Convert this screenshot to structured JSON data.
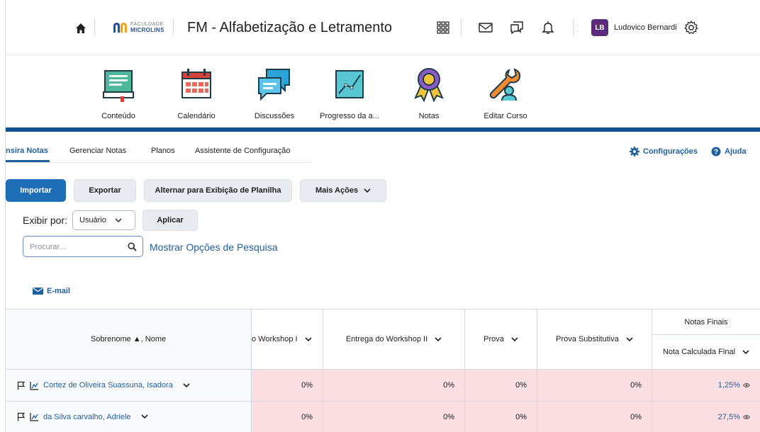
{
  "header": {
    "logo_top": "FACULDADE",
    "logo_bottom": "MICROLINS",
    "course_title": "FM - Alfabetização e Letramento",
    "user_initials": "LB",
    "user_name": "Ludovico Bernardi"
  },
  "nav": {
    "items": [
      {
        "label": "Conteúdo",
        "icon": "book-icon"
      },
      {
        "label": "Calendário",
        "icon": "calendar-icon"
      },
      {
        "label": "Discussões",
        "icon": "discussion-icon"
      },
      {
        "label": "Progresso da a...",
        "icon": "progress-chart-icon"
      },
      {
        "label": "Notas",
        "icon": "award-ribbon-icon"
      },
      {
        "label": "Editar Curso",
        "icon": "wrench-icon"
      }
    ]
  },
  "tabs": {
    "items": [
      "nsira Notas",
      "Gerenciar Notas",
      "Planos",
      "Assistente de Configuração"
    ],
    "active": "nsira Notas"
  },
  "links": {
    "settings": "Configurações",
    "help": "Ajuda"
  },
  "toolbar": {
    "import": "Importar",
    "export": "Exportar",
    "toggle_view": "Alternar para Exibição de Planilha",
    "more_actions": "Mais Ações"
  },
  "filter": {
    "view_by_label": "Exibir por:",
    "view_by_value": "Usuário",
    "apply": "Aplicar",
    "search_placeholder": "Procurar...",
    "search_options": "Mostrar Opções de Pesquisa",
    "email": "E-mail"
  },
  "grid": {
    "name_header": "Sobrenome ▲, Nome",
    "columns": [
      "o Workshop I",
      "Entrega do Workshop II",
      "Prova",
      "Prova Substitutiva"
    ],
    "final_group": "Notas Finais",
    "final_column": "Nota Calculada Final",
    "rows": [
      {
        "name": "Cortez de Oliveira Suassuna, Isadora",
        "values": [
          "0%",
          "0%",
          "0%",
          "0%"
        ],
        "final": "1,25%"
      },
      {
        "name": "da Silva carvalho, Adriele",
        "values": [
          "0%",
          "0%",
          "0%",
          "0%"
        ],
        "final": "27,5%"
      }
    ]
  },
  "colors": {
    "accent": "#1f5f9e",
    "primary_button": "#1f6fb8",
    "brand_rule": "#12508d",
    "grade_cell": "#fbdfe3",
    "avatar": "#5b2a7a"
  }
}
